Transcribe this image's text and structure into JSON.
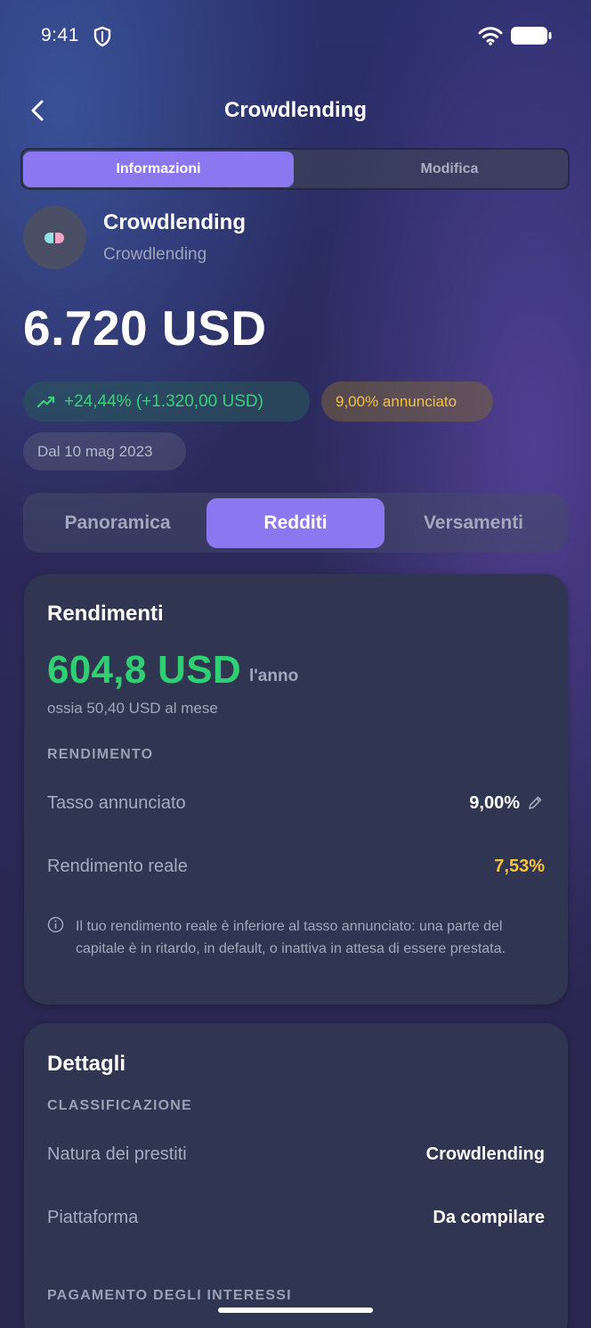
{
  "status_bar": {
    "time": "9:41"
  },
  "nav": {
    "title": "Crowdlending"
  },
  "segmented": {
    "info_label": "Informazioni",
    "edit_label": "Modifica"
  },
  "asset": {
    "name": "Crowdlending",
    "category": "Crowdlending"
  },
  "summary": {
    "total_value": "6.720 USD",
    "gain": "+24,44% (+1.320,00 USD)",
    "announced_rate": "9,00% annunciato",
    "since": "Dal 10 mag 2023"
  },
  "tabs": {
    "overview": "Panoramica",
    "income": "Redditi",
    "deposits": "Versamenti",
    "active": "Redditi"
  },
  "returns_card": {
    "title": "Rendimenti",
    "annual_amount": "604,8 USD",
    "per_year": "l'anno",
    "per_month": "ossia 50,40 USD al mese",
    "section_label": "RENDIMENTO",
    "rows": [
      {
        "label": "Tasso annunciato",
        "value": "9,00%"
      },
      {
        "label": "Rendimento reale",
        "value": "7,53%"
      }
    ],
    "info_text": "Il tuo rendimento reale è inferiore al tasso annunciato: una parte del capitale è in ritardo, in default, o inattiva in attesa di essere prestata."
  },
  "details_card": {
    "title": "Dettagli",
    "section_classification": "CLASSIFICAZIONE",
    "rows": [
      {
        "label": "Natura dei prestiti",
        "value": "Crowdlending"
      },
      {
        "label": "Piattaforma",
        "value": "Da compilare"
      }
    ],
    "section_interest": "PAGAMENTO DEGLI INTERESSI"
  },
  "colors": {
    "accent": "#8b78f0",
    "gain_green": "#2fcf72",
    "warning_yellow": "#f5c23c",
    "card_bg": "#303651"
  }
}
